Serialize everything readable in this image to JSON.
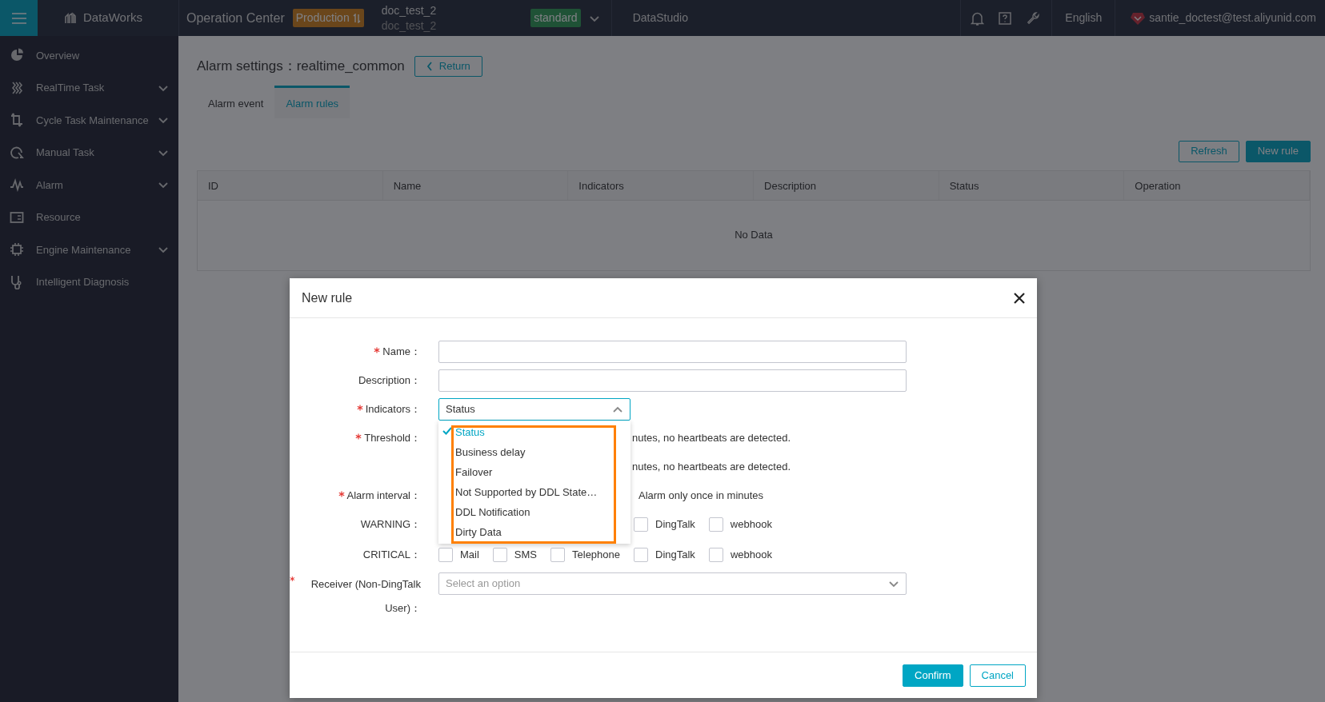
{
  "topbar": {
    "logo": "DataWorks",
    "module": "Operation Center",
    "env_badge": "Production",
    "workspace": [
      "doc_test_2",
      "doc_test_2"
    ],
    "mode_badge": "standard",
    "studio_link": "DataStudio",
    "language": "English",
    "user": "santie_doctest@test.aliyunid.com"
  },
  "sidebar": {
    "items": [
      {
        "label": "Overview",
        "expandable": false
      },
      {
        "label": "RealTime Task",
        "expandable": true
      },
      {
        "label": "Cycle Task Maintenance",
        "expandable": true
      },
      {
        "label": "Manual Task",
        "expandable": true
      },
      {
        "label": "Alarm",
        "expandable": true
      },
      {
        "label": "Resource",
        "expandable": false
      },
      {
        "label": "Engine Maintenance",
        "expandable": true
      },
      {
        "label": "Intelligent Diagnosis",
        "expandable": false
      }
    ]
  },
  "page": {
    "title": "Alarm settings：",
    "subject": "realtime_common",
    "return_button": "Return",
    "tabs": [
      {
        "label": "Alarm event",
        "selected": false
      },
      {
        "label": "Alarm rules",
        "selected": true
      }
    ],
    "buttons": [
      {
        "label": "Refresh",
        "kind": "outline"
      },
      {
        "label": "New rule",
        "kind": "primary"
      }
    ],
    "table": {
      "columns": [
        "ID",
        "Name",
        "Indicators",
        "Description",
        "Status",
        "Operation"
      ],
      "empty_text": "No Data"
    }
  },
  "dialog": {
    "title": "New rule",
    "fields": [
      {
        "kind": "input",
        "label": "Name：",
        "required": true
      },
      {
        "kind": "input",
        "label": "Description：",
        "required": false
      },
      {
        "kind": "select",
        "label": "Indicators：",
        "required": true,
        "value": "Status",
        "expanded": true,
        "options": [
          {
            "label": "Status",
            "selected": true
          },
          {
            "label": "Business delay",
            "selected": false
          },
          {
            "label": "Failover",
            "selected": false
          },
          {
            "label": "Not Supported by DDL State…",
            "selected": false
          },
          {
            "label": "DDL Notification",
            "selected": false
          },
          {
            "label": "Dirty Data",
            "selected": false
          }
        ]
      },
      {
        "kind": "text",
        "label": "Threshold：",
        "required": true,
        "text": "nutes, no heartbeats are detected."
      },
      {
        "kind": "text",
        "required": false,
        "text": "nutes, no heartbeats are detected."
      },
      {
        "kind": "text",
        "label": "Alarm interval：",
        "required": true,
        "text": "Alarm only once in minutes"
      },
      {
        "kind": "checks",
        "label": "WARNING：",
        "required": false,
        "options": [
          {
            "label": "DingTalk",
            "checked": false
          },
          {
            "label": "webhook",
            "checked": false
          }
        ]
      },
      {
        "kind": "checks",
        "label": "CRITICAL：",
        "required": false,
        "options": [
          {
            "label": "Mail",
            "checked": false
          },
          {
            "label": "SMS",
            "checked": false
          },
          {
            "label": "Telephone",
            "checked": false
          },
          {
            "label": "DingTalk",
            "checked": false
          },
          {
            "label": "webhook",
            "checked": false
          }
        ]
      },
      {
        "kind": "select",
        "label": "Receiver (Non-DingTalk User)：",
        "required": true,
        "placeholder": "Select an option",
        "expanded": false
      }
    ],
    "buttons": [
      {
        "label": "Confirm",
        "kind": "primary"
      },
      {
        "label": "Cancel",
        "kind": "outline"
      }
    ]
  }
}
